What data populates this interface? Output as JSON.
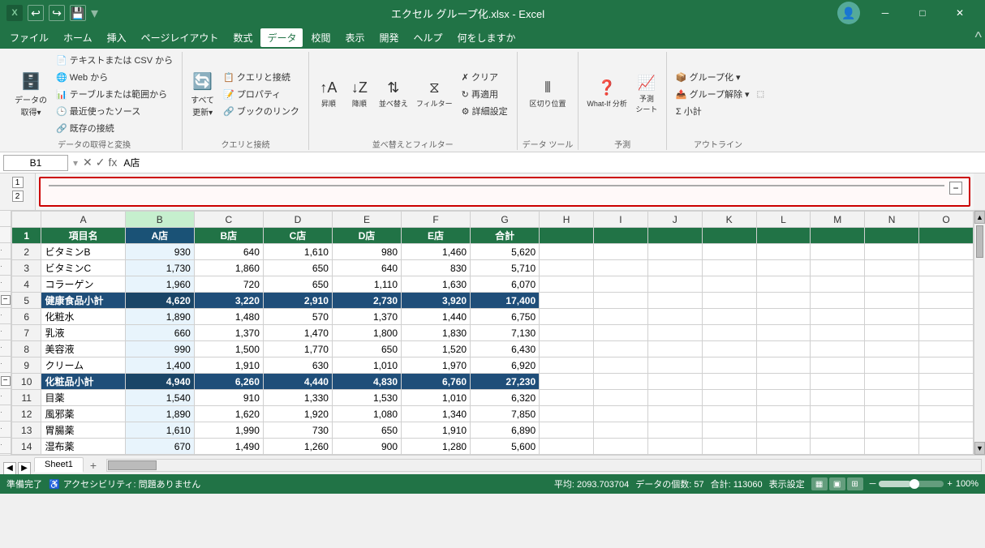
{
  "titleBar": {
    "appIcon": "X",
    "undoLabel": "↩",
    "redoLabel": "↪",
    "saveLabel": "💾",
    "title": "エクセル グループ化.xlsx - Excel",
    "profileIcon": "👤",
    "minimizeIcon": "─",
    "restoreIcon": "□",
    "closeIcon": "✕"
  },
  "menuBar": {
    "items": [
      "ファイル",
      "ホーム",
      "挿入",
      "ページレイアウト",
      "数式",
      "データ",
      "校閲",
      "表示",
      "開発",
      "ヘルプ",
      "何をしますか"
    ]
  },
  "ribbon": {
    "groups": [
      {
        "label": "データの取得と変換",
        "buttons": [
          "データの取得",
          "テキストまたはCSVから",
          "Webから",
          "テーブルまたは範囲から",
          "最近使ったソース",
          "既存の接続"
        ]
      },
      {
        "label": "クエリと接続",
        "buttons": [
          "すべて更新",
          "クエリと接続",
          "プロパティ",
          "ブックのリンク"
        ]
      },
      {
        "label": "並べ替えとフィルター",
        "buttons": [
          "昇順",
          "降順",
          "並べ替え",
          "フィルター",
          "クリア",
          "再適用",
          "詳細設定"
        ]
      },
      {
        "label": "データツール",
        "buttons": [
          "区切り位置"
        ]
      },
      {
        "label": "予測",
        "buttons": [
          "What-If分析",
          "予測シート"
        ]
      },
      {
        "label": "アウトライン",
        "buttons": [
          "グループ化",
          "グループ解除",
          "小計"
        ]
      }
    ]
  },
  "formulaBar": {
    "cellRef": "B1",
    "formula": "A店"
  },
  "groupControls": {
    "levels": [
      "1",
      "2"
    ],
    "collapseLabel": "−"
  },
  "grid": {
    "columns": [
      "",
      "A",
      "B",
      "C",
      "D",
      "E",
      "F",
      "G",
      "H",
      "I",
      "J",
      "K",
      "L",
      "M",
      "N",
      "O"
    ],
    "rows": [
      {
        "rowNum": "1",
        "isHeader": true,
        "cells": [
          "項目名",
          "A店",
          "B店",
          "C店",
          "D店",
          "E店",
          "合計",
          "",
          "",
          "",
          "",
          "",
          "",
          "",
          ""
        ]
      },
      {
        "rowNum": "2",
        "cells": [
          "ビタミンB",
          "930",
          "640",
          "1,610",
          "980",
          "1,460",
          "5,620",
          "",
          "",
          "",
          "",
          "",
          "",
          "",
          ""
        ]
      },
      {
        "rowNum": "3",
        "cells": [
          "ビタミンC",
          "1,730",
          "1,860",
          "650",
          "640",
          "830",
          "5,710",
          "",
          "",
          "",
          "",
          "",
          "",
          "",
          ""
        ]
      },
      {
        "rowNum": "4",
        "cells": [
          "コラーゲン",
          "1,960",
          "720",
          "650",
          "1,110",
          "1,630",
          "6,070",
          "",
          "",
          "",
          "",
          "",
          "",
          "",
          ""
        ]
      },
      {
        "rowNum": "5",
        "isSubtotal": true,
        "cells": [
          "健康食品小計",
          "4,620",
          "3,220",
          "2,910",
          "2,730",
          "3,920",
          "17,400",
          "",
          "",
          "",
          "",
          "",
          "",
          "",
          ""
        ]
      },
      {
        "rowNum": "6",
        "cells": [
          "化粧水",
          "1,890",
          "1,480",
          "570",
          "1,370",
          "1,440",
          "6,750",
          "",
          "",
          "",
          "",
          "",
          "",
          "",
          ""
        ]
      },
      {
        "rowNum": "7",
        "cells": [
          "乳液",
          "660",
          "1,370",
          "1,470",
          "1,800",
          "1,830",
          "7,130",
          "",
          "",
          "",
          "",
          "",
          "",
          "",
          ""
        ]
      },
      {
        "rowNum": "8",
        "cells": [
          "美容液",
          "990",
          "1,500",
          "1,770",
          "650",
          "1,520",
          "6,430",
          "",
          "",
          "",
          "",
          "",
          "",
          "",
          ""
        ]
      },
      {
        "rowNum": "9",
        "cells": [
          "クリーム",
          "1,400",
          "1,910",
          "630",
          "1,010",
          "1,970",
          "6,920",
          "",
          "",
          "",
          "",
          "",
          "",
          "",
          ""
        ]
      },
      {
        "rowNum": "10",
        "isSubtotal": true,
        "cells": [
          "化粧品小計",
          "4,940",
          "6,260",
          "4,440",
          "4,830",
          "6,760",
          "27,230",
          "",
          "",
          "",
          "",
          "",
          "",
          "",
          ""
        ]
      },
      {
        "rowNum": "11",
        "cells": [
          "目薬",
          "1,540",
          "910",
          "1,330",
          "1,530",
          "1,010",
          "6,320",
          "",
          "",
          "",
          "",
          "",
          "",
          "",
          ""
        ]
      },
      {
        "rowNum": "12",
        "cells": [
          "風邪薬",
          "1,890",
          "1,620",
          "1,920",
          "1,080",
          "1,340",
          "7,850",
          "",
          "",
          "",
          "",
          "",
          "",
          "",
          ""
        ]
      },
      {
        "rowNum": "13",
        "cells": [
          "胃腸薬",
          "1,610",
          "1,990",
          "730",
          "650",
          "1,910",
          "6,890",
          "",
          "",
          "",
          "",
          "",
          "",
          "",
          ""
        ]
      },
      {
        "rowNum": "14",
        "cells": [
          "湿布薬",
          "670",
          "1,490",
          "1,260",
          "900",
          "1,280",
          "5,600",
          "",
          "",
          "",
          "",
          "",
          "",
          "",
          ""
        ]
      }
    ],
    "groupIndicators": {
      "row5": "−",
      "row10": "−"
    }
  },
  "statusBar": {
    "ready": "準備完了",
    "accessibility": "アクセシビリティ: 問題ありません",
    "average": "平均: 2093.703704",
    "count": "データの個数: 57",
    "sum": "合計: 113060",
    "displaySettings": "表示設定",
    "zoom": "100%"
  },
  "sheetTabs": {
    "sheets": [
      "Sheet1"
    ],
    "addLabel": "+"
  }
}
